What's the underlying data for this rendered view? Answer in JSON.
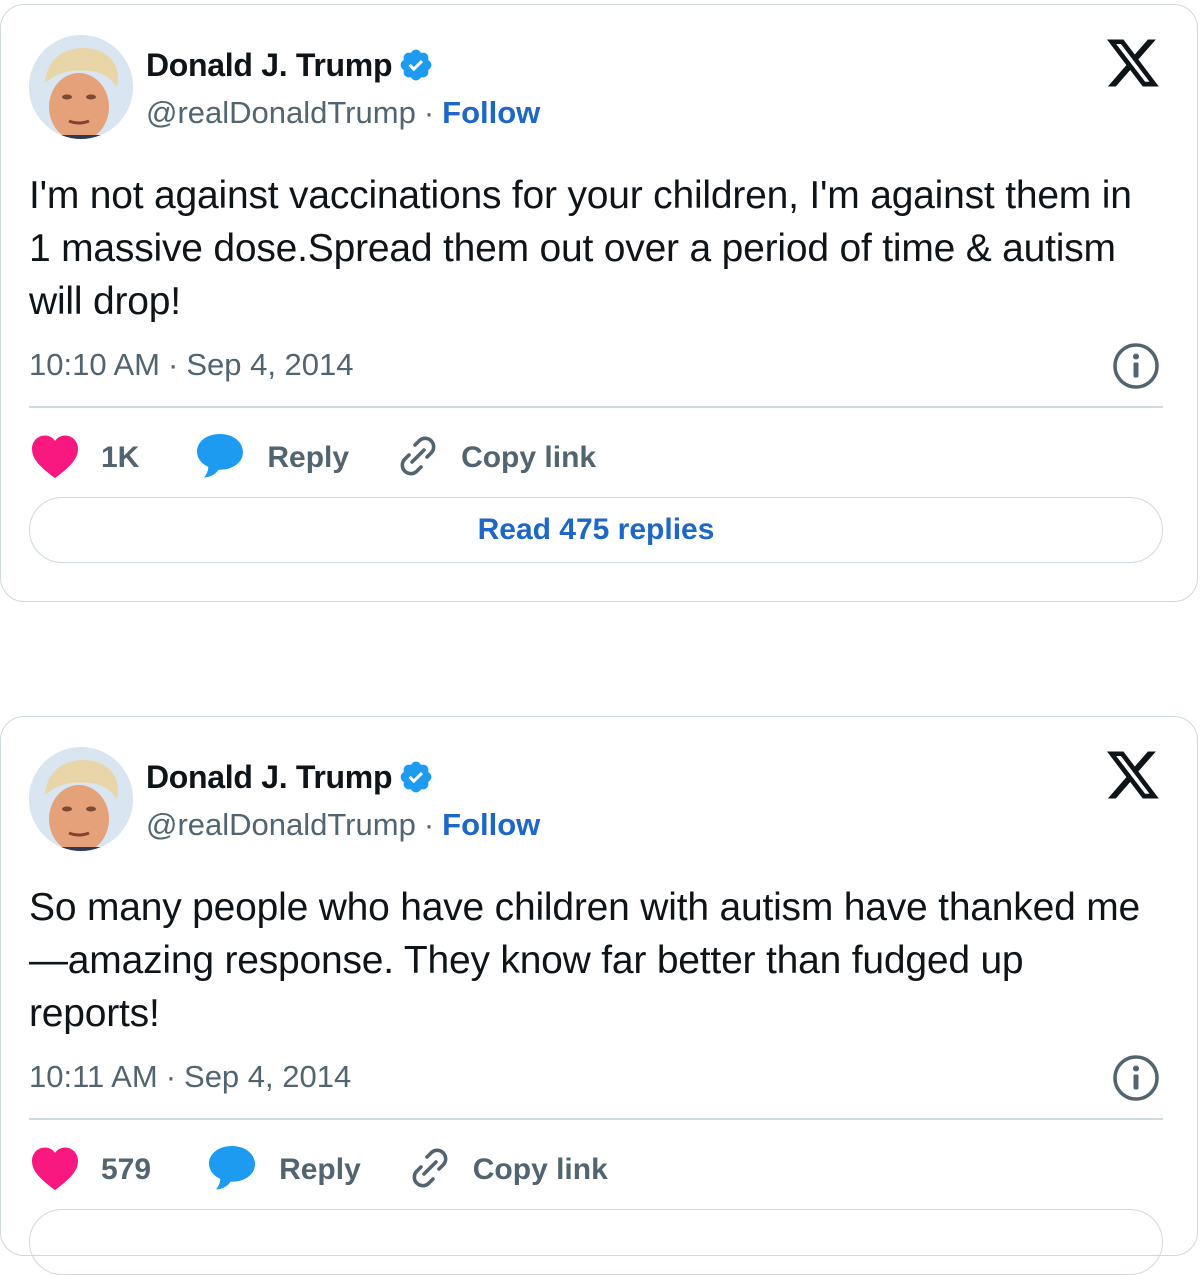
{
  "colors": {
    "link_blue": "#1d67c7",
    "verified_blue": "#1d9bf0",
    "like_pink": "#f91880",
    "text_primary": "#0f1419",
    "text_secondary": "#536471",
    "border": "#cfd9de"
  },
  "icons": {
    "verified": "verified-badge-icon",
    "brand": "x-logo-icon",
    "info": "info-icon",
    "like": "heart-icon",
    "reply": "speech-bubble-icon",
    "copy": "link-icon"
  },
  "tweets": [
    {
      "author_name": "Donald J. Trump",
      "handle": "@realDonaldTrump",
      "separator": "·",
      "follow_label": "Follow",
      "text": "I'm not against vaccinations for your children, I'm against them in 1 massive dose.Spread them out over a period of time & autism will drop!",
      "time": "10:10 AM",
      "date": "Sep 4, 2014",
      "likes": "1K",
      "reply_label": "Reply",
      "copy_label": "Copy link",
      "read_replies_label": "Read 475 replies"
    },
    {
      "author_name": "Donald J. Trump",
      "handle": "@realDonaldTrump",
      "separator": "·",
      "follow_label": "Follow",
      "text": "So many people who have children with autism have thanked me—amazing response. They know far better than fudged up reports!",
      "time": "10:11 AM",
      "date": "Sep 4, 2014",
      "likes": "579",
      "reply_label": "Reply",
      "copy_label": "Copy link"
    }
  ]
}
